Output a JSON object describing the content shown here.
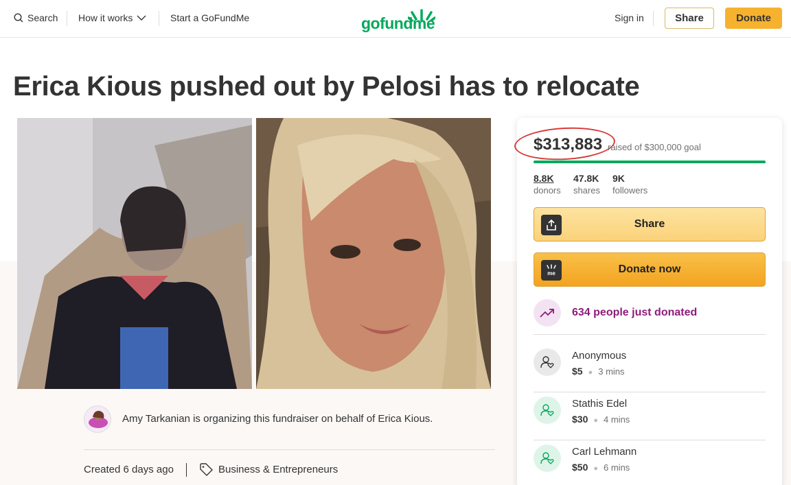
{
  "header": {
    "search": "Search",
    "how_it_works": "How it works",
    "start": "Start a GoFundMe",
    "logo": "gofundme",
    "sign_in": "Sign in",
    "share": "Share",
    "donate": "Donate"
  },
  "campaign": {
    "title": "Erica Kious pushed out by Pelosi has to relocate",
    "organizer_text": "Amy Tarkanian is organizing this fundraiser on behalf of Erica Kious.",
    "created": "Created 6 days ago",
    "category": "Business & Entrepreneurs"
  },
  "sidebar": {
    "raised": "$313,883",
    "goal_text": "raised of $300,000 goal",
    "progress": 1.0,
    "stats": [
      {
        "num": "8.8K",
        "label": "donors"
      },
      {
        "num": "47.8K",
        "label": "shares"
      },
      {
        "num": "9K",
        "label": "followers"
      }
    ],
    "share_btn": "Share",
    "donate_btn": "Donate now",
    "recent": "634 people just donated",
    "donations": [
      {
        "name": "Anonymous",
        "amount": "$5",
        "time": "3 mins"
      },
      {
        "name": "Stathis Edel",
        "amount": "$30",
        "time": "4 mins"
      },
      {
        "name": "Carl Lehmann",
        "amount": "$50",
        "time": "6 mins"
      }
    ]
  },
  "colors": {
    "brand_green": "#02a95c",
    "donate_yellow": "#f6b22e",
    "trend_purple": "#8e1c7c",
    "annotation_red": "#d83a3a"
  }
}
